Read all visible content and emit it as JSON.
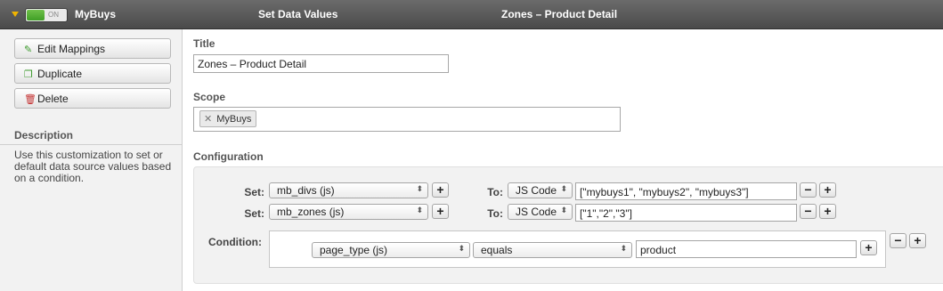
{
  "header": {
    "toggle_label": "ON",
    "app_name": "MyBuys",
    "customization_type": "Set Data Values",
    "customization_name": "Zones – Product Detail"
  },
  "sidebar": {
    "buttons": [
      {
        "label": "Edit Mappings",
        "icon": "edit-icon"
      },
      {
        "label": "Duplicate",
        "icon": "duplicate-icon"
      },
      {
        "label": "Delete",
        "icon": "trash-icon"
      }
    ],
    "description_heading": "Description",
    "description_text": "Use this customization to set or default data source values based on a condition."
  },
  "main": {
    "title_label": "Title",
    "title_value": "Zones – Product Detail",
    "scope_label": "Scope",
    "scope_tags": [
      "MyBuys"
    ],
    "configuration_label": "Configuration",
    "set_rows": [
      {
        "set_label": "Set:",
        "source": "mb_divs (js)",
        "to_label": "To:",
        "value_type": "JS Code",
        "value": "[\"mybuys1\", \"mybuys2\", \"mybuys3\"]"
      },
      {
        "set_label": "Set:",
        "source": "mb_zones (js)",
        "to_label": "To:",
        "value_type": "JS Code",
        "value": "[\"1\",\"2\",\"3\"]"
      }
    ],
    "condition": {
      "label": "Condition:",
      "field": "page_type (js)",
      "operator": "equals",
      "value": "product"
    },
    "plus_symbol": "+",
    "minus_symbol": "−"
  },
  "colors": {
    "header_bg": "#555555",
    "toggle_on": "#4caf2f",
    "caret": "#f0b400"
  }
}
